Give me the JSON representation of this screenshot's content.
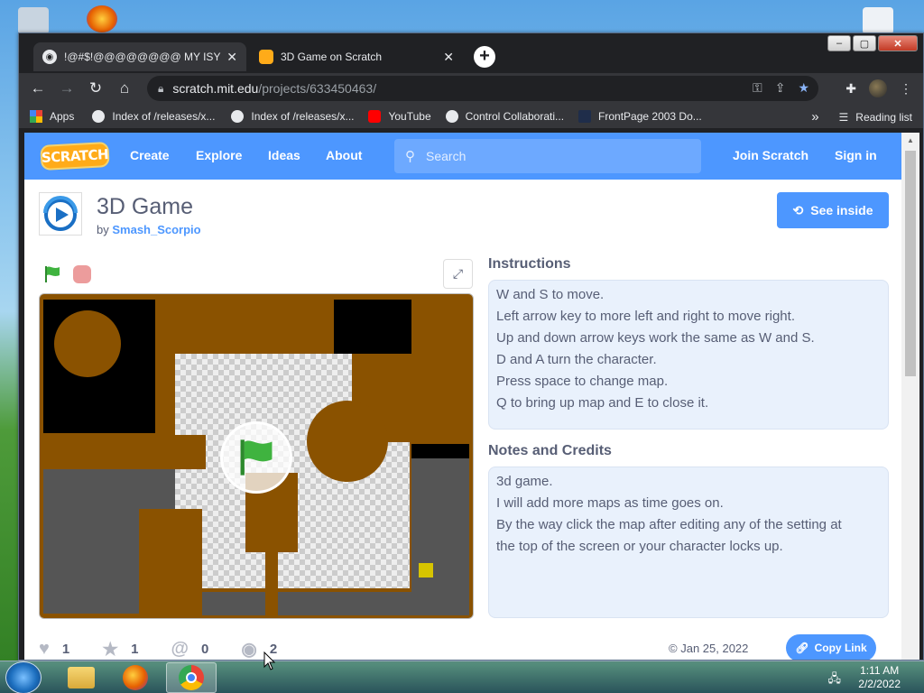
{
  "browser": {
    "tabs": [
      {
        "title": "!@#$!@@@@@@@@ MY ISYS PE",
        "active": true
      },
      {
        "title": "3D Game on Scratch",
        "active": false
      }
    ],
    "url_host": "scratch.mit.edu",
    "url_path": "/projects/633450463/",
    "bookmarks": [
      {
        "label": "Apps",
        "icon": "apps-grid-icon"
      },
      {
        "label": "Index of /releases/x...",
        "icon": "globe-icon"
      },
      {
        "label": "Index of /releases/x...",
        "icon": "globe-icon"
      },
      {
        "label": "YouTube",
        "icon": "youtube-icon"
      },
      {
        "label": "Control Collaborati...",
        "icon": "globe-icon"
      },
      {
        "label": "FrontPage 2003 Do...",
        "icon": "page-icon"
      }
    ],
    "more_bookmarks": "»",
    "reading_list": "Reading list"
  },
  "scratch_nav": {
    "logo": "SCRATCH",
    "links": [
      "Create",
      "Explore",
      "Ideas",
      "About"
    ],
    "search_placeholder": "Search",
    "join": "Join Scratch",
    "signin": "Sign in"
  },
  "project": {
    "title": "3D Game",
    "by": "by",
    "author": "Smash_Scorpio",
    "see_inside": "See inside",
    "instructions_title": "Instructions",
    "instructions": [
      "W and S to move.",
      "Left arrow key to more left and right to move right.",
      "Up and down arrow keys work the same as W and S.",
      "D and A turn the character.",
      "Press space to change map.",
      "Q to bring up map and E to close it."
    ],
    "notes_title": "Notes and Credits",
    "notes": [
      "3d game.",
      "I will add more maps as time goes on.",
      "By the way click the map after editing any of the setting at",
      "the top of the screen or your character locks up."
    ],
    "stats": {
      "loves": "1",
      "favorites": "1",
      "remixes": "0",
      "views": "2"
    },
    "shared_date": "Jan 25, 2022",
    "copy_link": "Copy Link"
  },
  "taskbar": {
    "time": "1:11 AM",
    "date": "2/2/2022"
  },
  "colors": {
    "scratch_blue": "#4d97ff",
    "stage_brown": "#8a5200",
    "chrome_dark": "#35363a"
  }
}
